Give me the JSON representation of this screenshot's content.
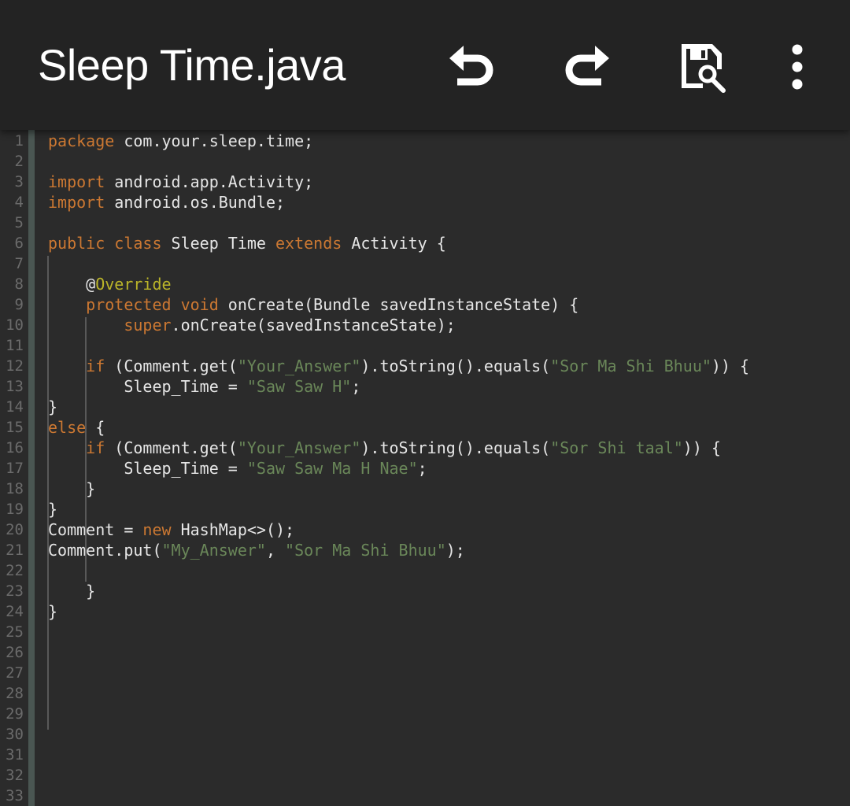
{
  "app_bar": {
    "title": "Sleep Time.java",
    "actions": [
      {
        "name": "undo-button",
        "icon": "undo-icon"
      },
      {
        "name": "redo-button",
        "icon": "redo-icon"
      },
      {
        "name": "save-button",
        "icon": "save-icon"
      },
      {
        "name": "overflow-menu-button",
        "icon": "more-vert-icon"
      }
    ]
  },
  "colors": {
    "keyword": "#cc7832",
    "string": "#6a8759",
    "annotation": "#bbb529",
    "text": "#e6e6e6",
    "background": "#2b2b2b"
  },
  "editor": {
    "line_count": 33,
    "lines": [
      [
        {
          "t": "package",
          "k": "kw"
        },
        {
          "t": " com.your.sleep.time;"
        }
      ],
      [],
      [
        {
          "t": "import",
          "k": "kw"
        },
        {
          "t": " android.app.Activity;"
        }
      ],
      [
        {
          "t": "import",
          "k": "kw"
        },
        {
          "t": " android.os.Bundle;"
        }
      ],
      [],
      [
        {
          "t": "public",
          "k": "kw"
        },
        {
          "t": " "
        },
        {
          "t": "class",
          "k": "kw"
        },
        {
          "t": " Sleep Time "
        },
        {
          "t": "extends",
          "k": "kw"
        },
        {
          "t": " Activity {"
        }
      ],
      [],
      [
        {
          "t": "    @"
        },
        {
          "t": "Override",
          "k": "ann"
        }
      ],
      [
        {
          "t": "    "
        },
        {
          "t": "protected",
          "k": "kw"
        },
        {
          "t": " "
        },
        {
          "t": "void",
          "k": "kw"
        },
        {
          "t": " onCreate(Bundle savedInstanceState) {"
        }
      ],
      [
        {
          "t": "        "
        },
        {
          "t": "super",
          "k": "kw"
        },
        {
          "t": ".onCreate(savedInstanceState);"
        }
      ],
      [],
      [
        {
          "t": "    "
        },
        {
          "t": "if",
          "k": "kw"
        },
        {
          "t": " (Comment.get("
        },
        {
          "t": "\"Your_Answer\"",
          "k": "str"
        },
        {
          "t": ").toString().equals("
        },
        {
          "t": "\"Sor Ma Shi Bhuu\"",
          "k": "str"
        },
        {
          "t": ")) {"
        }
      ],
      [
        {
          "t": "        Sleep_Time = "
        },
        {
          "t": "\"Saw Saw H\"",
          "k": "str"
        },
        {
          "t": ";"
        }
      ],
      [
        {
          "t": "}"
        }
      ],
      [
        {
          "t": "else",
          "k": "kw"
        },
        {
          "t": " {"
        }
      ],
      [
        {
          "t": "    "
        },
        {
          "t": "if",
          "k": "kw"
        },
        {
          "t": " (Comment.get("
        },
        {
          "t": "\"Your_Answer\"",
          "k": "str"
        },
        {
          "t": ").toString().equals("
        },
        {
          "t": "\"Sor Shi taal\"",
          "k": "str"
        },
        {
          "t": ")) {"
        }
      ],
      [
        {
          "t": "        Sleep_Time = "
        },
        {
          "t": "\"Saw Saw Ma H Nae\"",
          "k": "str"
        },
        {
          "t": ";"
        }
      ],
      [
        {
          "t": "    }"
        }
      ],
      [
        {
          "t": "}"
        }
      ],
      [
        {
          "t": "Comment = "
        },
        {
          "t": "new",
          "k": "kw"
        },
        {
          "t": " HashMap<>();"
        }
      ],
      [
        {
          "t": "Comment.put("
        },
        {
          "t": "\"My_Answer\"",
          "k": "str"
        },
        {
          "t": ", "
        },
        {
          "t": "\"Sor Ma Shi Bhuu\"",
          "k": "str"
        },
        {
          "t": ");"
        }
      ],
      [],
      [
        {
          "t": "    }"
        }
      ],
      [
        {
          "t": "}"
        }
      ]
    ]
  }
}
